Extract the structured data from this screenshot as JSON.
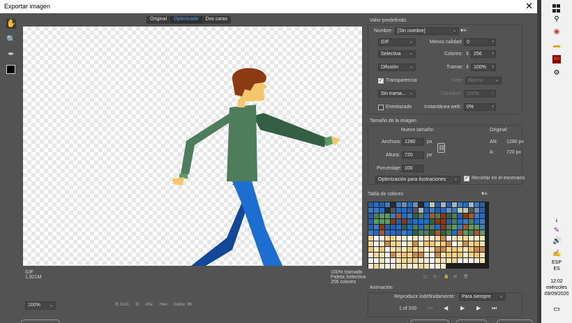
{
  "window": {
    "title": "Exportar imagen",
    "close_label": "✕"
  },
  "tabs": [
    {
      "label": "Original"
    },
    {
      "label": "Optimizado"
    },
    {
      "label": "Dos caras"
    }
  ],
  "canvas_info": {
    "format": "GIF",
    "size": "1,921M",
    "dither": "100% tramado",
    "palette": "Paleta Selectiva",
    "colors": "256 colores"
  },
  "bottom": {
    "zoom": "100%",
    "r": "R: 61G:",
    "b": "B:",
    "alpha": "Alfa:",
    "hex": "Hex:",
    "index": "Índice: 86"
  },
  "preset": {
    "section_title": "Valor predefinido",
    "name_label": "Nombre:",
    "name_value": "[Sin nombre]",
    "format": "GIF",
    "less_quality_label": "Menos calidad:",
    "less_quality_value": "0",
    "reduction": "Selectiva",
    "colors_label": "Colores:",
    "colors_value": "256",
    "dither_algorithm": "Difusión",
    "dither_label": "Tramar:",
    "dither_value": "100%",
    "transparency_label": "Transparencia",
    "matte_label": "Mate:",
    "matte_value": "Blanco",
    "transparency_dither": "Sin trama...",
    "amount_label": "Cantidad:",
    "amount_value": "100%",
    "interlaced_label": "Entrelazado",
    "web_snap_label": "Instantánea web:",
    "web_snap_value": "0%"
  },
  "image_size": {
    "section_title": "Tamaño de la imagen",
    "new_size_label": "Nuevo tamaño:",
    "original_label": "Original:",
    "width_label": "Anchura:",
    "width_value": "1280",
    "height_label": "Altura:",
    "height_value": "720",
    "unit": "px",
    "orig_w_label": "AN:",
    "orig_w_value": "1280 px",
    "orig_h_label": "A:",
    "orig_h_value": "720 px",
    "percent_label": "Porcentaje:",
    "percent_value": "100",
    "optimization": "Optimización para ilustraciones",
    "clip_label": "Recortar en el escenario"
  },
  "color_table": {
    "section_title": "Tabla de colores"
  },
  "animation": {
    "section_title": "Animación",
    "loop_label": "Reproducir indefinidamente:",
    "loop_value": "Para siempre",
    "frame_counter": "1 of 200"
  },
  "taskbar": {
    "language": "ESP",
    "region": "ES",
    "time": "12:02",
    "day": "miércoles",
    "date": "09/09/2020"
  },
  "colors": {
    "skin": "#f5c66b",
    "hair": "#8b3a12",
    "shirt": "#4e7d5b",
    "sleeve_dark": "#355f45",
    "jeans_light": "#1d6ed1",
    "jeans_dark": "#12479a"
  }
}
